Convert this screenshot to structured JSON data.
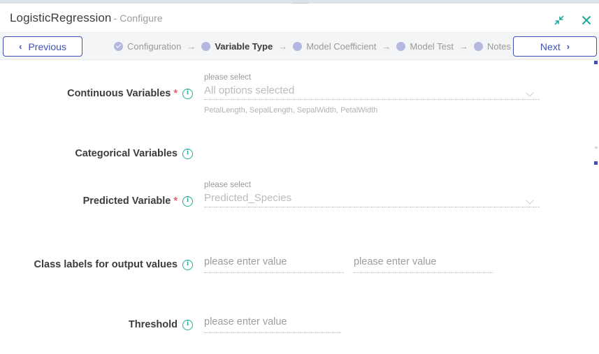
{
  "window": {
    "title": "LogisticRegression",
    "subtitle": "- Configure",
    "minimize_icon": "collapse-icon",
    "close_icon": "close-icon",
    "accent_teal": "#21a79b",
    "accent_indigo": "#4051b5"
  },
  "toolbar": {
    "previous_label": "Previous",
    "previous_chevron": "‹",
    "next_label": "Next",
    "next_chevron": "›"
  },
  "stepper": {
    "arrow": "→",
    "steps": [
      {
        "label": "Configuration",
        "state": "done"
      },
      {
        "label": "Variable Type",
        "state": "current"
      },
      {
        "label": "Model Coefficient",
        "state": "upcoming"
      },
      {
        "label": "Model Test",
        "state": "upcoming"
      },
      {
        "label": "Notes",
        "state": "upcoming"
      }
    ]
  },
  "form": {
    "fields": [
      {
        "label": "Continuous Variables",
        "required": "*",
        "type": "select",
        "hint": "please select",
        "value": "All options selected",
        "helper": "PetalLength, SepalLength, SepalWidth, PetalWidth"
      },
      {
        "label": "Categorical Variables",
        "required": "",
        "type": "label-only",
        "hint": "",
        "value": "",
        "helper": ""
      },
      {
        "label": "Predicted Variable",
        "required": "*",
        "type": "select",
        "hint": "please select",
        "value": "Predicted_Species",
        "helper": ""
      },
      {
        "label": "Class labels for output values",
        "required": "",
        "type": "dual-text",
        "hint": "",
        "value": "please enter value",
        "value2": "please enter value",
        "helper": ""
      },
      {
        "label": "Threshold",
        "required": "",
        "type": "text",
        "hint": "",
        "value": "please enter value",
        "helper": ""
      }
    ]
  }
}
